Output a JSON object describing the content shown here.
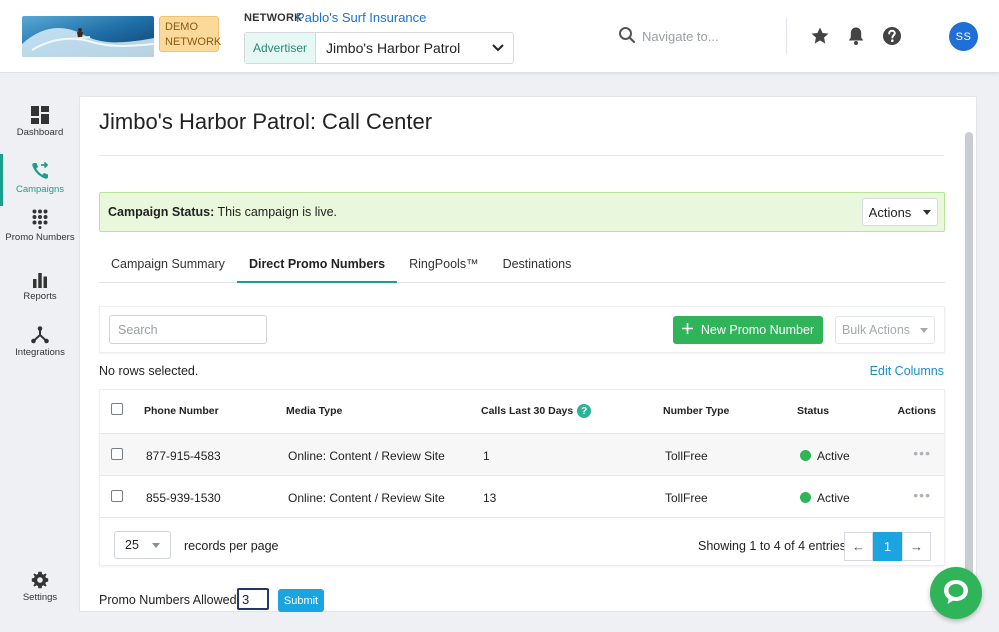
{
  "header": {
    "demo_badge": "DEMO NETWORK",
    "network_label": "NETWORK",
    "network_name": "Pablo's Surf Insurance",
    "advertiser_label": "Advertiser",
    "advertiser_value": "Jimbo's Harbor Patrol",
    "nav_placeholder": "Navigate to...",
    "avatar_initials": "SS"
  },
  "sidebar": {
    "items": [
      {
        "label": "Dashboard",
        "icon": "dashboard-icon"
      },
      {
        "label": "Campaigns",
        "icon": "campaigns-icon",
        "active": true
      },
      {
        "label": "Promo Numbers",
        "icon": "keypad-icon"
      },
      {
        "label": "Reports",
        "icon": "bar-chart-icon"
      },
      {
        "label": "Integrations",
        "icon": "integrations-icon"
      },
      {
        "label": "Settings",
        "icon": "gear-icon"
      }
    ]
  },
  "page": {
    "title": "Jimbo's Harbor Patrol: Call Center",
    "status_label": "Campaign Status:",
    "status_text": "This campaign is live.",
    "actions_label": "Actions"
  },
  "tabs": [
    {
      "label": "Campaign Summary"
    },
    {
      "label": "Direct Promo Numbers",
      "active": true
    },
    {
      "label": "RingPools™"
    },
    {
      "label": "Destinations"
    }
  ],
  "toolbar": {
    "search_placeholder": "Search",
    "new_label": "New Promo Number",
    "bulk_label": "Bulk Actions"
  },
  "table": {
    "rows_selected": "No rows selected.",
    "edit_columns": "Edit Columns",
    "headers": [
      "Phone Number",
      "Media Type",
      "Calls Last 30 Days",
      "Number Type",
      "Status",
      "Actions"
    ],
    "rows": [
      {
        "phone": "877-915-4583",
        "media": "Online: Content / Review Site",
        "calls": "1",
        "type": "TollFree",
        "status": "Active"
      },
      {
        "phone": "855-939-1530",
        "media": "Online: Content / Review Site",
        "calls": "13",
        "type": "TollFree",
        "status": "Active"
      }
    ],
    "per_page": "25",
    "per_page_label": "records per page",
    "showing": "Showing 1 to 4 of 4 entries",
    "prev": "←",
    "page": "1",
    "next": "→"
  },
  "footer": {
    "allowed_label": "Promo Numbers Allowed:",
    "allowed_value": "3",
    "submit_label": "Submit"
  },
  "colors": {
    "accent": "#1aa08a",
    "primary_green": "#2fb45a",
    "link_blue": "#1a90c8"
  }
}
